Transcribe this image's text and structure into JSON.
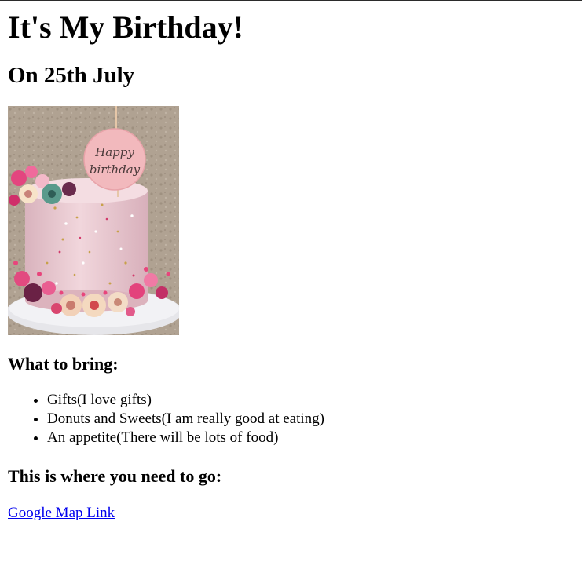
{
  "page": {
    "title": "It's My Birthday!",
    "subtitle": "On 25th July"
  },
  "image": {
    "topper_line1": "Happy",
    "topper_line2": "birthday"
  },
  "bring_section": {
    "heading": "What to bring:",
    "items": [
      "Gifts(I love gifts)",
      "Donuts and Sweets(I am really good at eating)",
      "An appetite(There will be lots of food)"
    ]
  },
  "location_section": {
    "heading": "This is where you need to go:",
    "link_label": "Google Map Link"
  },
  "colors": {
    "link": "#0000ee",
    "cake_pink": "#e9c7cf",
    "wall": "#b8aa9c"
  }
}
